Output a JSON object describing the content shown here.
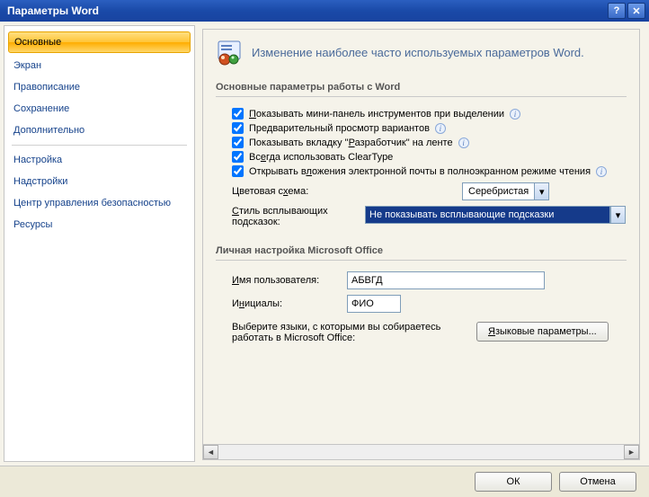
{
  "window": {
    "title": "Параметры Word"
  },
  "sidebar": {
    "items": [
      "Основные",
      "Экран",
      "Правописание",
      "Сохранение",
      "Дополнительно",
      "Настройка",
      "Надстройки",
      "Центр управления безопасностью",
      "Ресурсы"
    ]
  },
  "header": {
    "text": "Изменение наиболее часто используемых параметров Word."
  },
  "section1": {
    "title": "Основные параметры работы с Word",
    "check_minipanel": "Показывать мини-панель инструментов при выделении",
    "check_preview": "Предварительный просмотр вариантов",
    "check_devtab": "Показывать вкладку \"Разработчик\" на ленте",
    "check_cleartype": "Всегда использовать ClearType",
    "check_attach": "Открывать вложения электронной почты в полноэкранном режиме чтения",
    "color_label": "Цветовая схема:",
    "color_value": "Серебристая",
    "tooltip_label": "Стиль всплывающих подсказок:",
    "tooltip_value": "Не показывать всплывающие подсказки"
  },
  "section2": {
    "title": "Личная настройка Microsoft Office",
    "username_label": "Имя пользователя:",
    "username_value": "АБВГД",
    "initials_label": "Инициалы:",
    "initials_value": "ФИО",
    "lang_note": "Выберите языки, с которыми вы собираетесь работать в Microsoft Office:",
    "lang_button": "Языковые параметры..."
  },
  "footer": {
    "ok": "ОК",
    "cancel": "Отмена"
  }
}
